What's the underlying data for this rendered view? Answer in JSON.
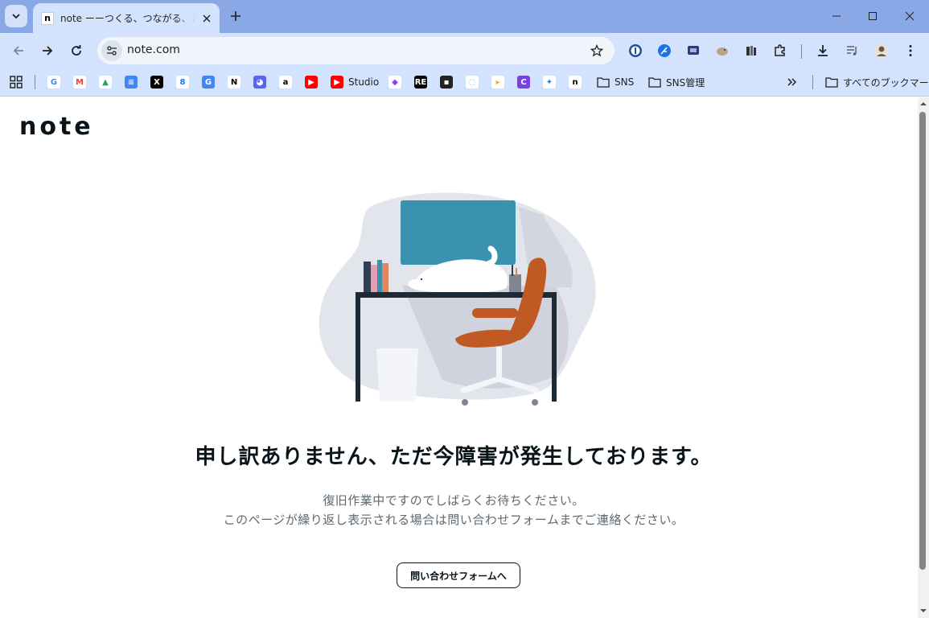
{
  "browser": {
    "tab": {
      "title": "note ーーつくる、つながる、とどける。",
      "favicon": "n"
    },
    "url": "note.com",
    "bookmarks": [
      {
        "name": "google",
        "label": "",
        "icon": "G",
        "color": "#ffffff",
        "fg": "#4285f4"
      },
      {
        "name": "gmail",
        "label": "",
        "icon": "M",
        "color": "#ffffff",
        "fg": "#ea4335"
      },
      {
        "name": "drive",
        "label": "",
        "icon": "▲",
        "color": "#ffffff",
        "fg": "#1fa463"
      },
      {
        "name": "docs",
        "label": "",
        "icon": "≡",
        "color": "#4285f4",
        "fg": "#ffffff"
      },
      {
        "name": "x",
        "label": "",
        "icon": "X",
        "color": "#000000",
        "fg": "#ffffff"
      },
      {
        "name": "calendar",
        "label": "",
        "icon": "8",
        "color": "#ffffff",
        "fg": "#1a73e8"
      },
      {
        "name": "translate",
        "label": "",
        "icon": "G",
        "color": "#4285f4",
        "fg": "#ffffff"
      },
      {
        "name": "notion",
        "label": "",
        "icon": "N",
        "color": "#ffffff",
        "fg": "#000000"
      },
      {
        "name": "discord",
        "label": "",
        "icon": "◕",
        "color": "#5865f2",
        "fg": "#ffffff"
      },
      {
        "name": "amazon",
        "label": "",
        "icon": "a",
        "color": "#ffffff",
        "fg": "#000000"
      },
      {
        "name": "youtube",
        "label": "",
        "icon": "▶",
        "color": "#ff0000",
        "fg": "#ffffff"
      },
      {
        "name": "youtube-studio",
        "label": "Studio",
        "icon": "▶",
        "color": "#ff0000",
        "fg": "#ffffff"
      },
      {
        "name": "canva",
        "label": "",
        "icon": "◆",
        "color": "#ffffff",
        "fg": "#8b3dff"
      },
      {
        "name": "re",
        "label": "",
        "icon": "RE",
        "color": "#000000",
        "fg": "#ffffff"
      },
      {
        "name": "ext-bag",
        "label": "",
        "icon": "▪",
        "color": "#222222",
        "fg": "#ffffff"
      },
      {
        "name": "ext-cloud",
        "label": "",
        "icon": "◌",
        "color": "#ffffff",
        "fg": "#7ec8e3"
      },
      {
        "name": "ext-yellow",
        "label": "",
        "icon": "▸",
        "color": "#ffffff",
        "fg": "#f0b400"
      },
      {
        "name": "ext-c",
        "label": "",
        "icon": "C",
        "color": "#7b3fe4",
        "fg": "#ffffff"
      },
      {
        "name": "bluesky",
        "label": "",
        "icon": "✦",
        "color": "#ffffff",
        "fg": "#1185fe"
      },
      {
        "name": "note",
        "label": "",
        "icon": "n",
        "color": "#ffffff",
        "fg": "#000000"
      },
      {
        "name": "folder-sns",
        "label": "SNS",
        "icon": "folder",
        "color": "",
        "fg": ""
      },
      {
        "name": "folder-sns-admin",
        "label": "SNS管理",
        "icon": "folder",
        "color": "",
        "fg": ""
      }
    ],
    "all_bookmarks_label": "すべてのブックマーク"
  },
  "page": {
    "logo": "note",
    "title": "申し訳ありません、ただ今障害が発生しております。",
    "message_line1": "復旧作業中ですのでしばらくお待ちください。",
    "message_line2": "このページが繰り返し表示される場合は問い合わせフォームまでご連絡ください。",
    "contact_button": "問い合わせフォームへ"
  },
  "colors": {
    "tabstrip": "#8aa8e6",
    "toolbar": "#d3e3fd",
    "monitor": "#3a92ae",
    "chair": "#c05a24",
    "desk": "#1c2a35",
    "blob": "#e3e5ec"
  }
}
